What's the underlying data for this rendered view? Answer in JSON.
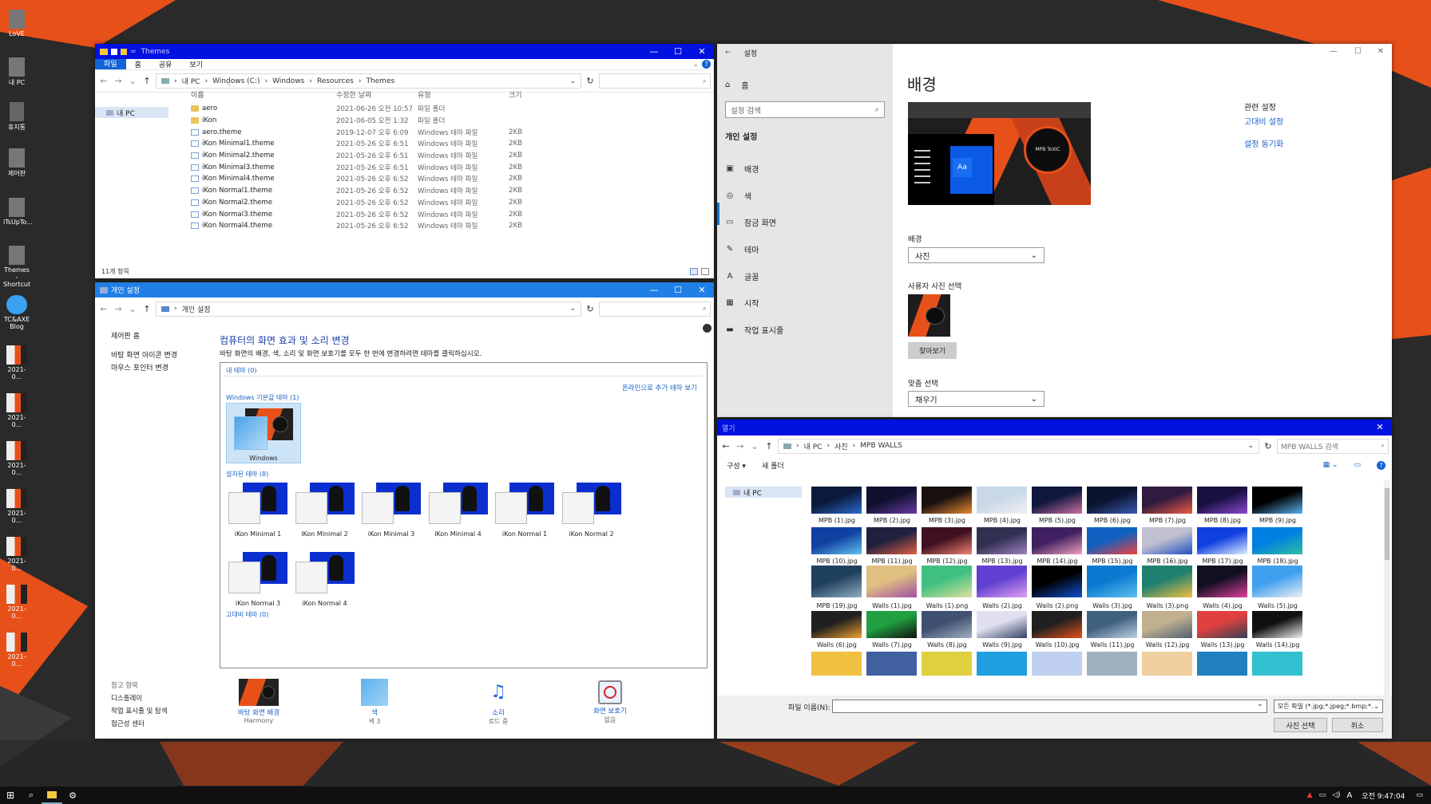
{
  "desktop": {
    "icons": [
      {
        "label": "LoVE",
        "icon": "user-icon"
      },
      {
        "label": "내 PC",
        "icon": "pc-icon"
      },
      {
        "label": "휴지통",
        "icon": "recycle-bin-icon"
      },
      {
        "label": "제어판",
        "icon": "control-panel-icon"
      },
      {
        "label": "iTsUpTo...",
        "icon": "document-icon"
      },
      {
        "label": "Themes - Shortcut",
        "icon": "shortcut-icon"
      },
      {
        "label": "TC&AXE Blog",
        "icon": "cloud-icon"
      },
      {
        "label": "2021-0...",
        "icon": "image-icon"
      },
      {
        "label": "2021-0...",
        "icon": "image-icon"
      },
      {
        "label": "2021-0...",
        "icon": "image-icon"
      },
      {
        "label": "2021-0...",
        "icon": "image-icon"
      },
      {
        "label": "2021-0...",
        "icon": "image-icon"
      },
      {
        "label": "2021-0...",
        "icon": "image-icon"
      },
      {
        "label": "2021-0...",
        "icon": "image-icon"
      }
    ]
  },
  "explorer": {
    "title": "Themes",
    "ribbon_tabs": [
      "파일",
      "홈",
      "공유",
      "보기"
    ],
    "path": [
      "내 PC",
      "Windows (C:)",
      "Windows",
      "Resources",
      "Themes"
    ],
    "nav_item": "내 PC",
    "columns": [
      "이름",
      "수정한 날짜",
      "유형",
      "크기"
    ],
    "rows": [
      {
        "name": "aero",
        "date": "2021-06-26 오전 10:57",
        "type": "파일 폴더",
        "size": "",
        "kind": "folder"
      },
      {
        "name": "iKon",
        "date": "2021-06-05 오전 1:32",
        "type": "파일 폴더",
        "size": "",
        "kind": "folder"
      },
      {
        "name": "aero.theme",
        "date": "2019-12-07 오후 6:09",
        "type": "Windows 테마 파일",
        "size": "2KB",
        "kind": "theme"
      },
      {
        "name": "iKon Minimal1.theme",
        "date": "2021-05-26 오후 6:51",
        "type": "Windows 테마 파일",
        "size": "2KB",
        "kind": "theme"
      },
      {
        "name": "iKon Minimal2.theme",
        "date": "2021-05-26 오후 6:51",
        "type": "Windows 테마 파일",
        "size": "2KB",
        "kind": "theme"
      },
      {
        "name": "iKon Minimal3.theme",
        "date": "2021-05-26 오후 6:51",
        "type": "Windows 테마 파일",
        "size": "2KB",
        "kind": "theme"
      },
      {
        "name": "iKon Minimal4.theme",
        "date": "2021-05-26 오후 6:52",
        "type": "Windows 테마 파일",
        "size": "2KB",
        "kind": "theme"
      },
      {
        "name": "iKon Normal1.theme",
        "date": "2021-05-26 오후 6:52",
        "type": "Windows 테마 파일",
        "size": "2KB",
        "kind": "theme"
      },
      {
        "name": "iKon Normal2.theme",
        "date": "2021-05-26 오후 6:52",
        "type": "Windows 테마 파일",
        "size": "2KB",
        "kind": "theme"
      },
      {
        "name": "iKon Normal3.theme",
        "date": "2021-05-26 오후 6:52",
        "type": "Windows 테마 파일",
        "size": "2KB",
        "kind": "theme"
      },
      {
        "name": "iKon Normal4.theme",
        "date": "2021-05-26 오후 6:52",
        "type": "Windows 테마 파일",
        "size": "2KB",
        "kind": "theme"
      }
    ],
    "status": "11개 항목"
  },
  "personalize": {
    "title": "개인 설정",
    "path": "개인 설정",
    "side_home": "제어판 홈",
    "side_links": [
      "바탕 화면 아이콘 변경",
      "마우스 포인터 변경"
    ],
    "heading": "컴퓨터의 화면 효과 및 소리 변경",
    "description": "바탕 화면의 배경, 색, 소리 및 화면 보호기를 모두 한 번에 변경하려면 테마를 클릭하십시오.",
    "my_themes": "내 테마 (0)",
    "online_link": "온라인으로 추가 테마 보기",
    "default_group": "Windows 기본값 테마 (1)",
    "default_theme": "Windows",
    "installed_group": "설치된 테마 (8)",
    "installed": [
      "iKon Minimal 1",
      "iKon Minimal 2",
      "iKon Minimal 3",
      "iKon Minimal 4",
      "iKon Normal 1",
      "iKon Normal 2",
      "iKon Normal 3",
      "iKon Normal 4"
    ],
    "high_contrast": "고대비 테마 (0)",
    "see_also_title": "참고 항목",
    "see_also": [
      "디스플레이",
      "작업 표시줄 및 탐색",
      "접근성 센터"
    ],
    "bottom": [
      {
        "label": "바탕 화면 배경",
        "sub": "Harmony"
      },
      {
        "label": "색",
        "sub": "색 3"
      },
      {
        "label": "소리",
        "sub": "로드 중"
      },
      {
        "label": "화면 보호기",
        "sub": "없음"
      }
    ]
  },
  "settings": {
    "title": "설정",
    "home": "홈",
    "search_placeholder": "설정 검색",
    "section": "개인 설정",
    "nav": [
      {
        "label": "배경",
        "icon": "picture-icon"
      },
      {
        "label": "색",
        "icon": "palette-icon"
      },
      {
        "label": "잠금 화면",
        "icon": "lock-screen-icon"
      },
      {
        "label": "테마",
        "icon": "theme-icon"
      },
      {
        "label": "글꼴",
        "icon": "font-icon"
      },
      {
        "label": "시작",
        "icon": "start-icon"
      },
      {
        "label": "작업 표시줄",
        "icon": "taskbar-icon"
      }
    ],
    "page_title": "배경",
    "preview_sample": "Aa",
    "preview_logo": "MPB ToXiC",
    "bg_label": "배경",
    "bg_value": "사진",
    "choose_label": "사용자 사진 선택",
    "browse": "찾아보기",
    "fit_label": "맞춤 선택",
    "fit_value": "채우기",
    "related_title": "관련 설정",
    "related": [
      "고대비 설정",
      "설정 동기화"
    ]
  },
  "open_dialog": {
    "title": "열기",
    "path": [
      "내 PC",
      "사진",
      "MPB WALLS"
    ],
    "search_placeholder": "MPB WALLS 검색",
    "organize": "구성 ▾",
    "new_folder": "새 폴더",
    "nav_item": "내 PC",
    "files": [
      "MPB (1).jpg",
      "MPB (2).jpg",
      "MPB (3).jpg",
      "MPB (4).jpg",
      "MPB (5).jpg",
      "MPB (6).jpg",
      "MPB (7).jpg",
      "MPB (8).jpg",
      "MPB (9).jpg",
      "MPB (10).jpg",
      "MPB (11).jpg",
      "MPB (12).jpg",
      "MPB (13).jpg",
      "MPB (14).jpg",
      "MPB (15).jpg",
      "MPB (16).jpg",
      "MPB (17).jpg",
      "MPB (18).jpg",
      "MPB (19).jpg",
      "Walls (1).jpg",
      "Walls (1).png",
      "Walls (2).jpg",
      "Walls (2).png",
      "Walls (3).jpg",
      "Walls (3).png",
      "Walls (4).jpg",
      "Walls (5).jpg",
      "Walls (6).jpg",
      "Walls (7).jpg",
      "Walls (8).jpg",
      "Walls (9).jpg",
      "Walls (10).jpg",
      "Walls (11).jpg",
      "Walls (12).jpg",
      "Walls (13).jpg",
      "Walls (14).jpg"
    ],
    "filename_label": "파일 이름(N):",
    "filter": "모든 파일 (*.jpg;*.jpeg;*.bmp;*.",
    "ok": "사진 선택",
    "cancel": "취소"
  },
  "taskbar": {
    "ime": "A",
    "time": "오전 9:47:04"
  }
}
